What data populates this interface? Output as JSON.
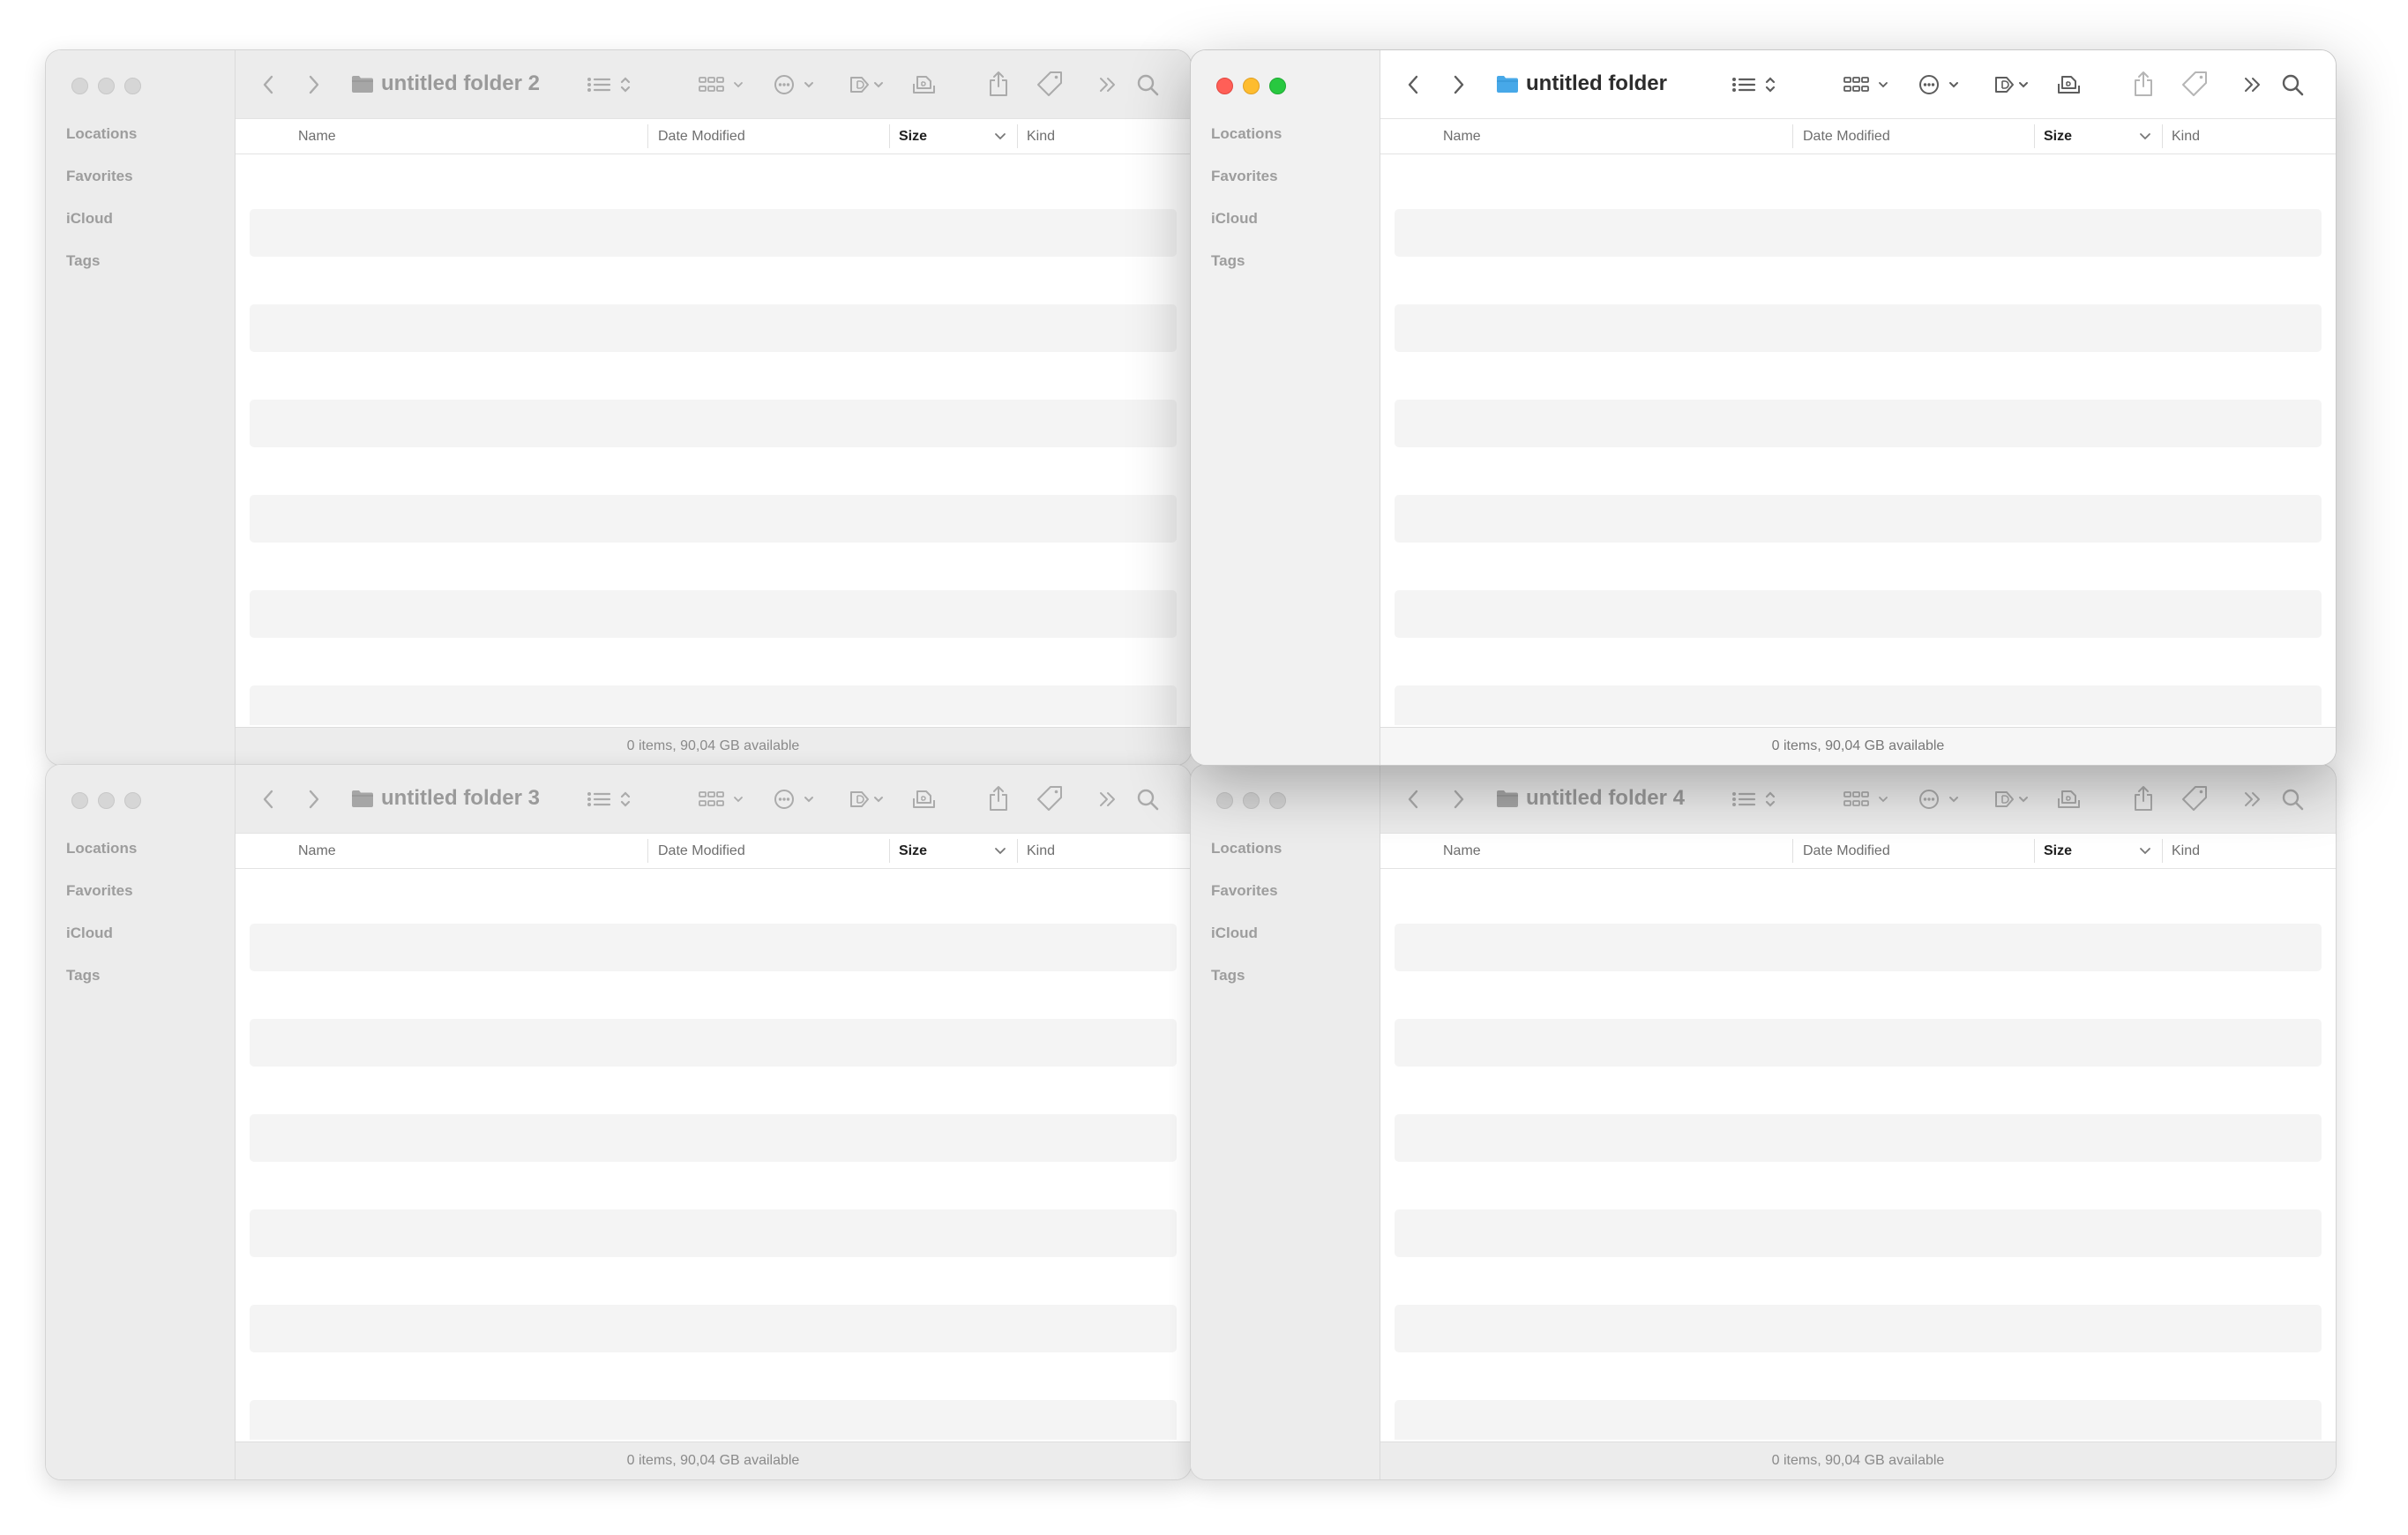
{
  "colors": {
    "close": "#ff5f57",
    "minimize": "#febc2e",
    "zoom": "#28c840",
    "folder_active": "#47a8e8",
    "folder_inactive": "#a6a6a6"
  },
  "sidebar_labels": [
    "Locations",
    "Favorites",
    "iCloud",
    "Tags"
  ],
  "columns": {
    "name": "Name",
    "date_modified": "Date Modified",
    "size": "Size",
    "kind": "Kind",
    "sorted_by": "Size"
  },
  "status_text": "0 items, 90,04 GB available",
  "toolbar_icons": [
    "chevron-left-icon",
    "chevron-right-icon",
    "folder-icon",
    "list-view-icon",
    "group-icon",
    "more-actions-icon",
    "tag-icon",
    "airdrop-icon",
    "share-icon",
    "tag-outline-icon",
    "double-chevron-icon",
    "search-icon"
  ],
  "windows": [
    {
      "title": "untitled folder 2",
      "active": false
    },
    {
      "title": "untitled folder",
      "active": true
    },
    {
      "title": "untitled folder 3",
      "active": false
    },
    {
      "title": "untitled folder 4",
      "active": false
    }
  ]
}
